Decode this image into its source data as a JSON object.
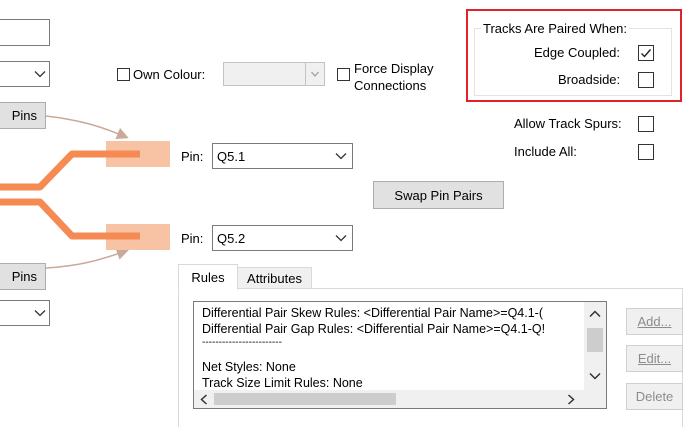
{
  "left_panel": {
    "top_pins_button_label": "Pins",
    "bottom_pins_button_label": "Pins"
  },
  "own_colour": {
    "label": "Own Colour:"
  },
  "force_display": {
    "line1": "Force Display",
    "line2": "Connections"
  },
  "tracks_group": {
    "title": "Tracks Are Paired When:",
    "edge_coupled_label": "Edge Coupled:",
    "edge_coupled_checked": true,
    "broadside_label": "Broadside:",
    "broadside_checked": false
  },
  "options": {
    "allow_track_spurs_label": "Allow Track Spurs:",
    "include_all_label": "Include All:"
  },
  "pins": {
    "pin1_label": "Pin:",
    "pin1_value": "Q5.1",
    "pin2_label": "Pin:",
    "pin2_value": "Q5.2"
  },
  "swap_button_label": "Swap Pin Pairs",
  "tabs": [
    {
      "label": "Rules",
      "active": true
    },
    {
      "label": "Attributes",
      "active": false
    }
  ],
  "rules_list": {
    "lines": [
      "Differential Pair Skew Rules: <Differential Pair Name>=Q4.1-(",
      "Differential Pair Gap Rules: <Differential Pair Name>=Q4.1-Q!",
      "------------------------",
      "Net Styles: None",
      "Track Size Limit Rules: None"
    ]
  },
  "side_buttons": {
    "add": "Add...",
    "edit": "Edit...",
    "delete": "Delete"
  },
  "colors": {
    "track_orange": "#f58a52",
    "pad_fill": "#f8c2a4",
    "highlight_red": "#e0232a"
  }
}
